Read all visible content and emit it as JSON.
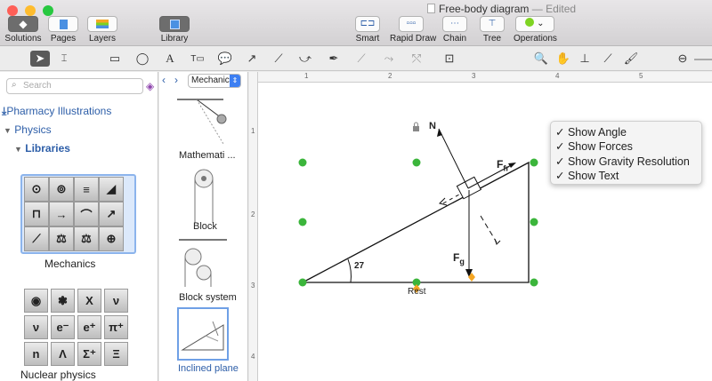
{
  "window": {
    "title": "Free-body diagram",
    "edited": "— Edited"
  },
  "toolbar": {
    "solutions": "Solutions",
    "pages": "Pages",
    "layers": "Layers",
    "library": "Library",
    "smart": "Smart",
    "rapid_draw": "Rapid Draw",
    "chain": "Chain",
    "tree": "Tree",
    "operations": "Operations"
  },
  "sidebar": {
    "search_placeholder": "Search",
    "pharmacy": "Pharmacy Illustrations",
    "physics": "Physics",
    "libraries": "Libraries",
    "mechanics": "Mechanics",
    "nuclear": "Nuclear physics",
    "nuclear_symbols": [
      "",
      "",
      "X",
      "ν",
      "ν",
      "e⁻",
      "e⁺",
      "π⁺",
      "n",
      "Λ",
      "Σ⁺",
      "Ξ"
    ]
  },
  "library": {
    "dropdown": "Mechanics",
    "items": [
      "Mathemati ...",
      "Block",
      "Block system",
      "Inclined plane"
    ]
  },
  "diagram": {
    "label_n": "N",
    "label_ffr": "F",
    "label_ffr_sub": "fr",
    "label_fg": "F",
    "label_fg_sub": "g",
    "angle": "27",
    "rest": "Rest"
  },
  "ruler": {
    "top": [
      "1",
      "2",
      "3",
      "4",
      "5",
      "6",
      "7",
      "8"
    ],
    "left": [
      "1",
      "2",
      "3",
      "4"
    ]
  },
  "menu": {
    "items": [
      "Show Angle",
      "Show Forces",
      "Show Gravity Resolution",
      "Show Text"
    ],
    "check": "✓"
  }
}
